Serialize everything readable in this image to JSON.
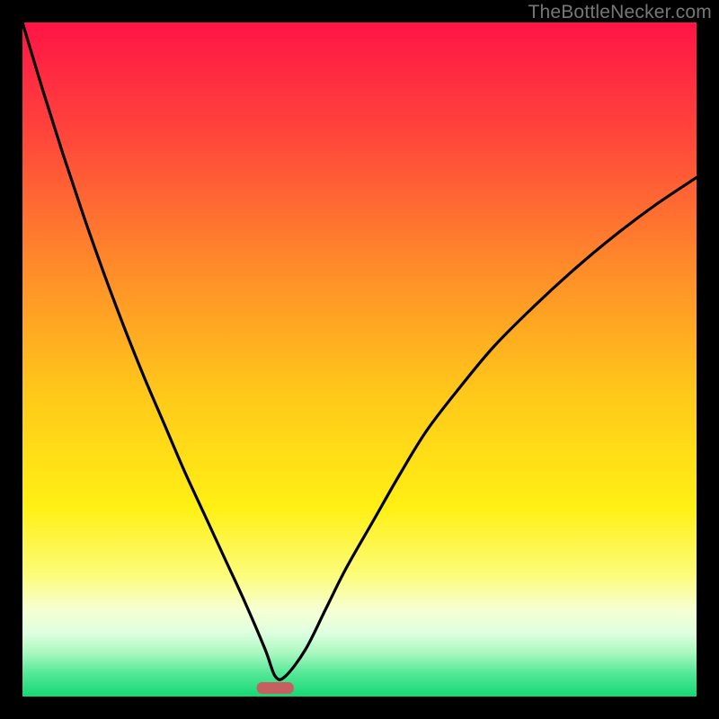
{
  "watermark": "TheBottleNecker.com",
  "chart_data": {
    "type": "line",
    "title": "",
    "xlabel": "",
    "ylabel": "",
    "xlim": [
      0,
      100
    ],
    "ylim": [
      0,
      100
    ],
    "gradient_stops": [
      {
        "offset": 0,
        "color": "#ff1446"
      },
      {
        "offset": 0.18,
        "color": "#ff4a3a"
      },
      {
        "offset": 0.36,
        "color": "#ff8a2a"
      },
      {
        "offset": 0.55,
        "color": "#ffc81a"
      },
      {
        "offset": 0.72,
        "color": "#fff014"
      },
      {
        "offset": 0.82,
        "color": "#fcfc7a"
      },
      {
        "offset": 0.87,
        "color": "#f7ffd2"
      },
      {
        "offset": 0.905,
        "color": "#dfffe0"
      },
      {
        "offset": 0.935,
        "color": "#aaf8c0"
      },
      {
        "offset": 0.965,
        "color": "#55e897"
      },
      {
        "offset": 1.0,
        "color": "#14d874"
      }
    ],
    "series": [
      {
        "name": "bottleneck-curve",
        "x": [
          0,
          3,
          6,
          9,
          12,
          15,
          18,
          21,
          24,
          27,
          30,
          33,
          36,
          37.5,
          39,
          42,
          45,
          48,
          52,
          56,
          60,
          65,
          70,
          76,
          82,
          88,
          94,
          100
        ],
        "y": [
          100,
          90,
          80.5,
          71.5,
          63,
          55,
          47.5,
          40.5,
          33.5,
          27,
          20.5,
          14,
          7,
          3,
          3,
          7,
          13,
          19,
          26,
          33,
          39.5,
          46,
          52,
          58,
          63.5,
          68.5,
          73,
          77
        ]
      }
    ],
    "marker": {
      "name": "sweet-spot-marker",
      "x": 37.5,
      "width_pct": 5.5,
      "color": "#c66060"
    }
  }
}
